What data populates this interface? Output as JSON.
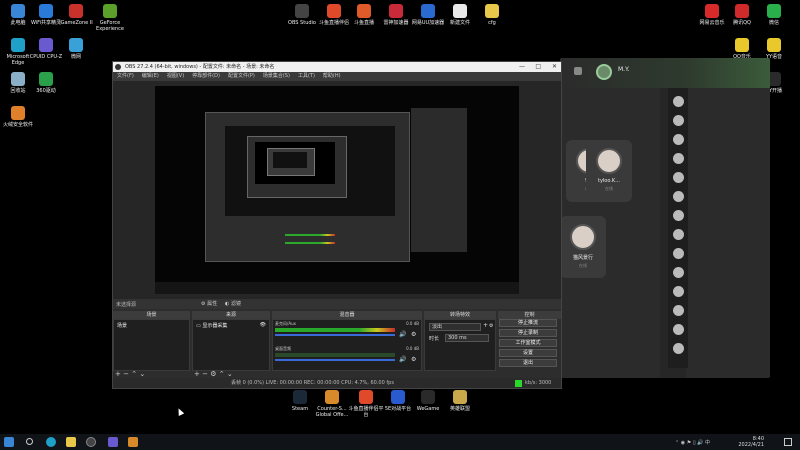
{
  "desktop_left": [
    {
      "label": "此电脑",
      "color": "#3a86d6"
    },
    {
      "label": "WiFi共享精灵",
      "color": "#2a7ad8"
    },
    {
      "label": "iGameZone II",
      "color": "#c8322a"
    },
    {
      "label": "GeForce Experience",
      "color": "#5aa02a"
    },
    {
      "label": "Microsoft Edge",
      "color": "#1fa0c8"
    },
    {
      "label": "CPUID CPU-Z",
      "color": "#6a5ad0"
    },
    {
      "label": "微网",
      "color": "#3aa0d8"
    },
    {
      "label": "回收站",
      "color": "#8ab0c8"
    },
    {
      "label": "360驱动",
      "color": "#2aa04a"
    },
    {
      "label": "火绒安全软件",
      "color": "#e0802a"
    }
  ],
  "desktop_top": [
    {
      "label": "OBS Studio",
      "color": "#444444"
    },
    {
      "label": "斗鱼直播伴侣",
      "color": "#e04a2a"
    },
    {
      "label": "斗鱼直播",
      "color": "#e05a2a"
    },
    {
      "label": "雷神加速器",
      "color": "#c82a3a"
    },
    {
      "label": "网易UU加速器",
      "color": "#2a6ad0"
    },
    {
      "label": "新建文件",
      "color": "#e8e8e8"
    },
    {
      "label": "cfg",
      "color": "#e8c84a"
    }
  ],
  "desktop_right": [
    {
      "label": "网易云音乐",
      "color": "#d82a2a"
    },
    {
      "label": "腾讯QQ",
      "color": "#d02a2a"
    },
    {
      "label": "微信",
      "color": "#2ab04a"
    },
    {
      "label": "QQ音乐",
      "color": "#e8c82a"
    },
    {
      "label": "YY语音",
      "color": "#e8c82a"
    },
    {
      "label": "YY开播",
      "color": "#2a2a2a"
    }
  ],
  "desktop_bottom": [
    {
      "label": "Steam",
      "color": "#1b2838"
    },
    {
      "label": "Counter-S... Global Offe...",
      "color": "#d88a2a"
    },
    {
      "label": "斗鱼直播伴侣平台",
      "color": "#e04a2a"
    },
    {
      "label": "5E对战平台",
      "color": "#2a5ad0"
    },
    {
      "label": "WeGame",
      "color": "#2a2a2a"
    },
    {
      "label": "英雄联盟",
      "color": "#c8a84a"
    }
  ],
  "obs": {
    "title": "OBS 27.2.4 (64-bit, windows) - 配置文件: 未命名 - 场景: 未命名",
    "menu": [
      "文件(F)",
      "编辑(E)",
      "视图(V)",
      "停靠部件(D)",
      "配置文件(P)",
      "场景集合(S)",
      "工具(T)",
      "帮助(H)"
    ],
    "source_bar": {
      "label": "未选择源",
      "props": "属性",
      "filters": "滤镜"
    },
    "docks": {
      "scenes": "场景",
      "sources": "来源",
      "mixer": "混音器",
      "transitions": "转场特效",
      "controls": "控制"
    },
    "scene_item": "场景",
    "source_item": "显示器采集",
    "mixer_tracks": [
      {
        "name": "麦克风/Aux",
        "db": "0.0 dB"
      },
      {
        "name": "桌面音频",
        "db": "0.0 dB"
      }
    ],
    "transition": {
      "type": "淡出",
      "duration_label": "时长",
      "duration_value": "300 ms"
    },
    "controls": [
      "停止推流",
      "停止录制",
      "工作室模式",
      "设置",
      "退出"
    ],
    "status": "丢帧 0 (0.0%)   LIVE: 00:00:00   REC: 00:00:00   CPU: 4.7%, 60.00 fps",
    "status_right": "kb/s: 3000"
  },
  "chat_app": {
    "username": "M.Y.",
    "cards": [
      {
        "name": "9...",
        "sub": "在线"
      },
      {
        "name": "tyloo.K...",
        "sub": "在线"
      },
      {
        "name": "猫风景行",
        "sub": "在线"
      }
    ]
  },
  "taskbar": {
    "time": "8:40",
    "date": "2022/4/21"
  }
}
